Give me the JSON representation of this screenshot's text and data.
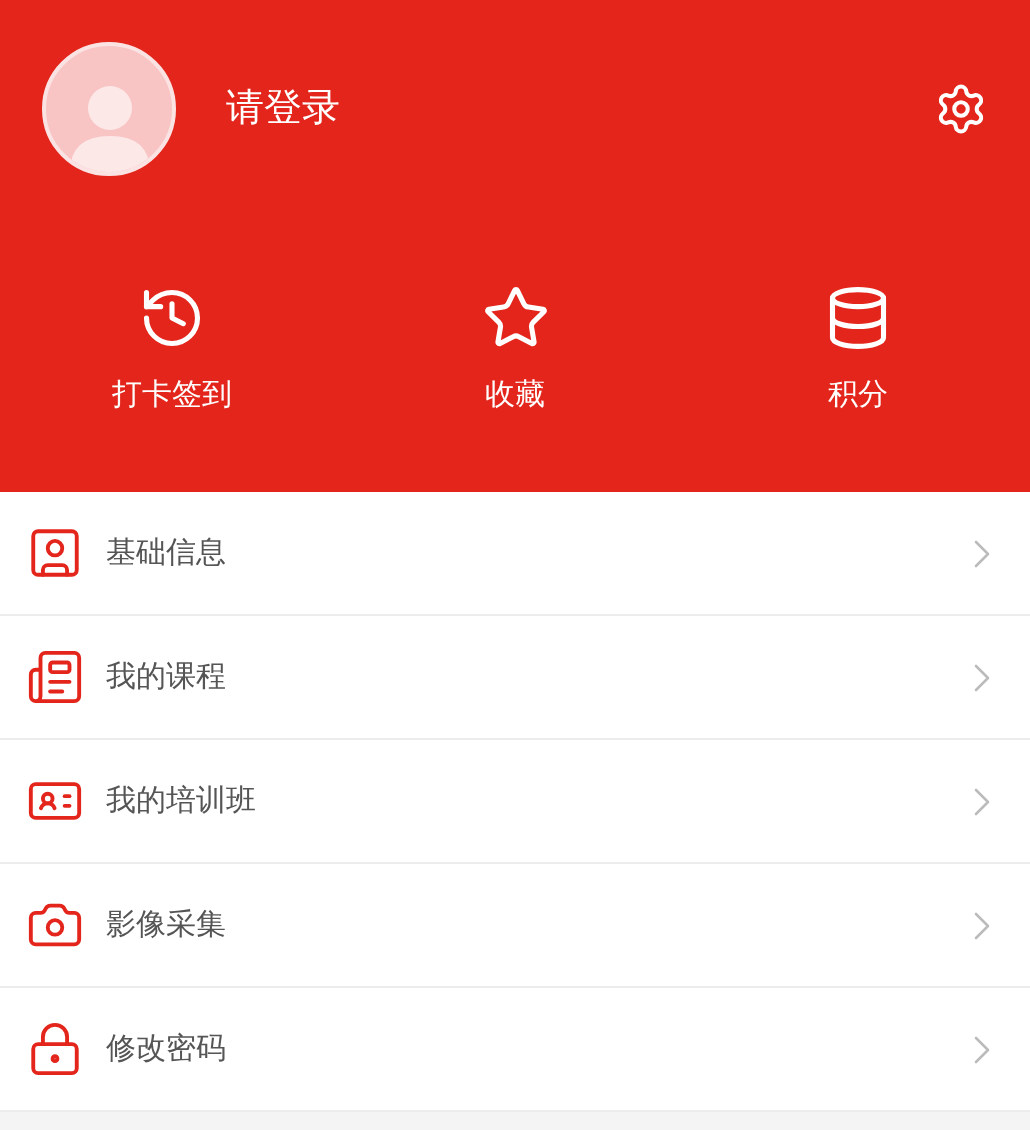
{
  "header": {
    "login_text": "请登录"
  },
  "quick_actions": [
    {
      "kind": "checkin",
      "label": "打卡签到"
    },
    {
      "kind": "favorite",
      "label": "收藏"
    },
    {
      "kind": "points",
      "label": "积分"
    }
  ],
  "menu": [
    {
      "kind": "profile",
      "label": "基础信息"
    },
    {
      "kind": "courses",
      "label": "我的课程"
    },
    {
      "kind": "classes",
      "label": "我的培训班"
    },
    {
      "kind": "camera",
      "label": "影像采集"
    },
    {
      "kind": "password",
      "label": "修改密码"
    }
  ]
}
